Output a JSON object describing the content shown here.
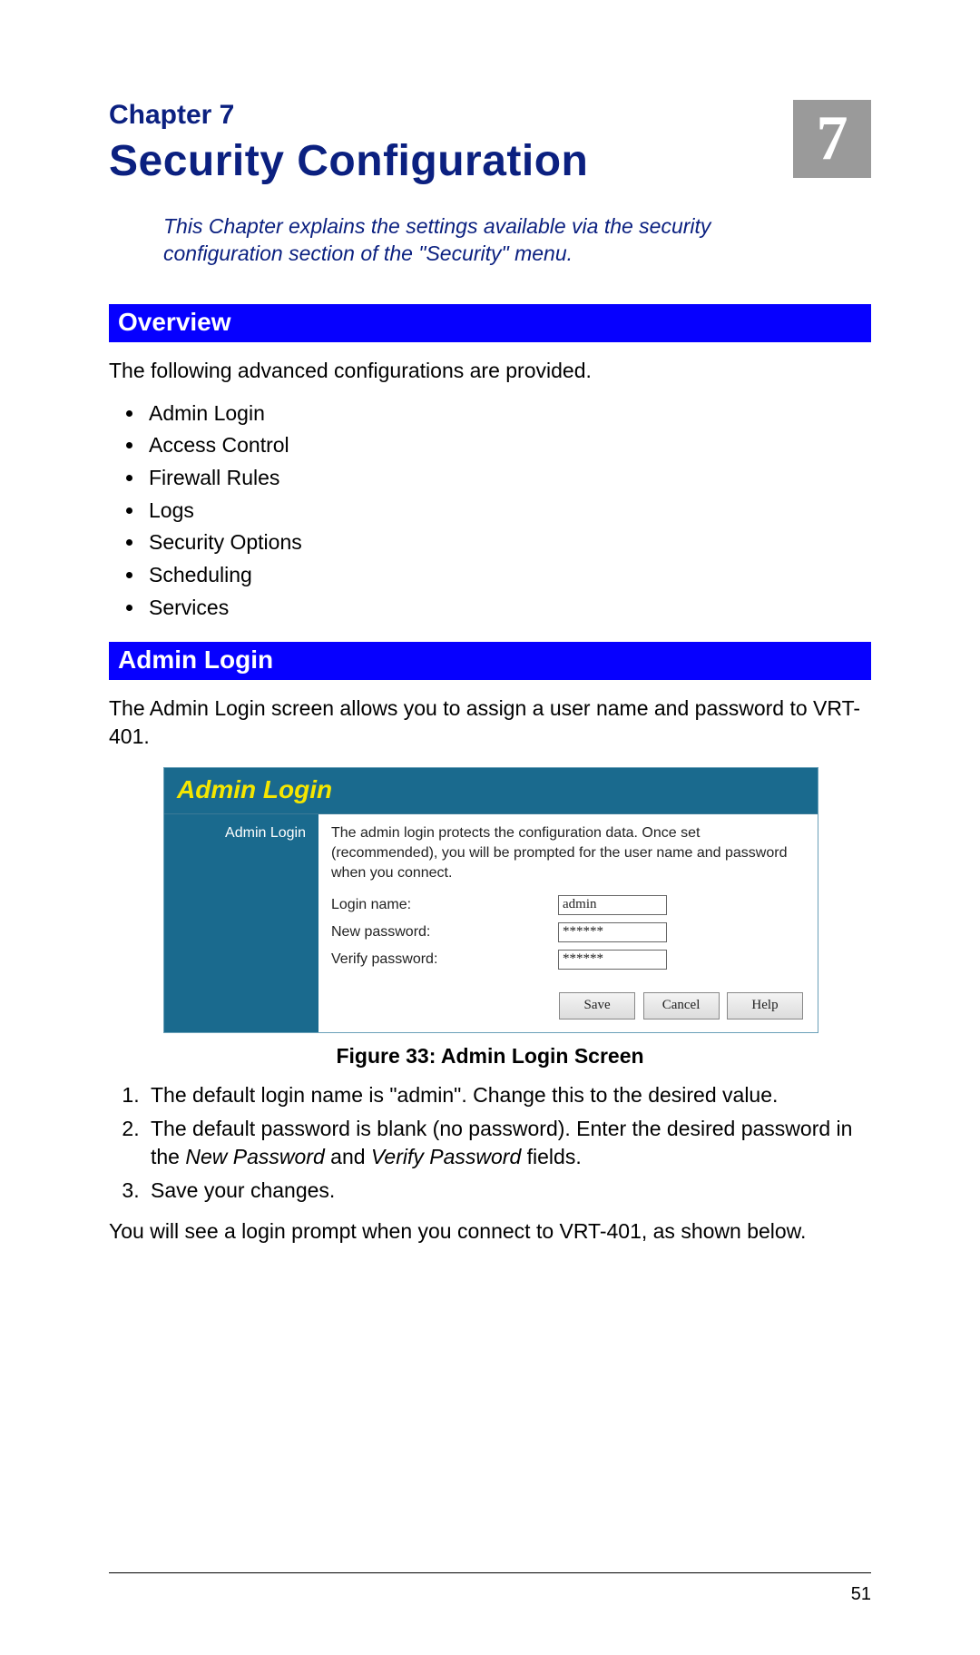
{
  "chapter": {
    "label": "Chapter 7",
    "title": "Security Configuration",
    "badge": "7",
    "intro": "This Chapter explains the settings available via the security configuration section of the \"Security\" menu."
  },
  "sections": {
    "overview": {
      "heading": "Overview",
      "lead": "The following advanced configurations are provided.",
      "items": [
        "Admin Login",
        "Access Control",
        "Firewall Rules",
        "Logs",
        "Security Options",
        "Scheduling",
        "Services"
      ]
    },
    "admin_login": {
      "heading": "Admin Login",
      "lead": "The Admin Login screen allows you to assign a user name and password to VRT-401."
    }
  },
  "figure": {
    "panel_title": "Admin Login",
    "side_label": "Admin Login",
    "description": "The admin login protects the configuration data. Once set (recommended), you will be prompted for the user name and password when you connect.",
    "login_name_label": "Login name:",
    "login_name_value": "admin",
    "new_password_label": "New password:",
    "new_password_value": "******",
    "verify_password_label": "Verify password:",
    "verify_password_value": "******",
    "buttons": {
      "save": "Save",
      "cancel": "Cancel",
      "help": "Help"
    },
    "caption": "Figure 33: Admin Login Screen"
  },
  "steps": {
    "s1": "The default login name is \"admin\". Change this to the desired value.",
    "s2a": "The default password is blank (no password). Enter the desired password in the ",
    "s2b_italic": "New Password",
    "s2c": " and ",
    "s2d_italic": "Verify Password",
    "s2e": " fields.",
    "s3": "Save your changes."
  },
  "closing": "You will see a login prompt when you connect to VRT-401, as shown below.",
  "page_number": "51"
}
